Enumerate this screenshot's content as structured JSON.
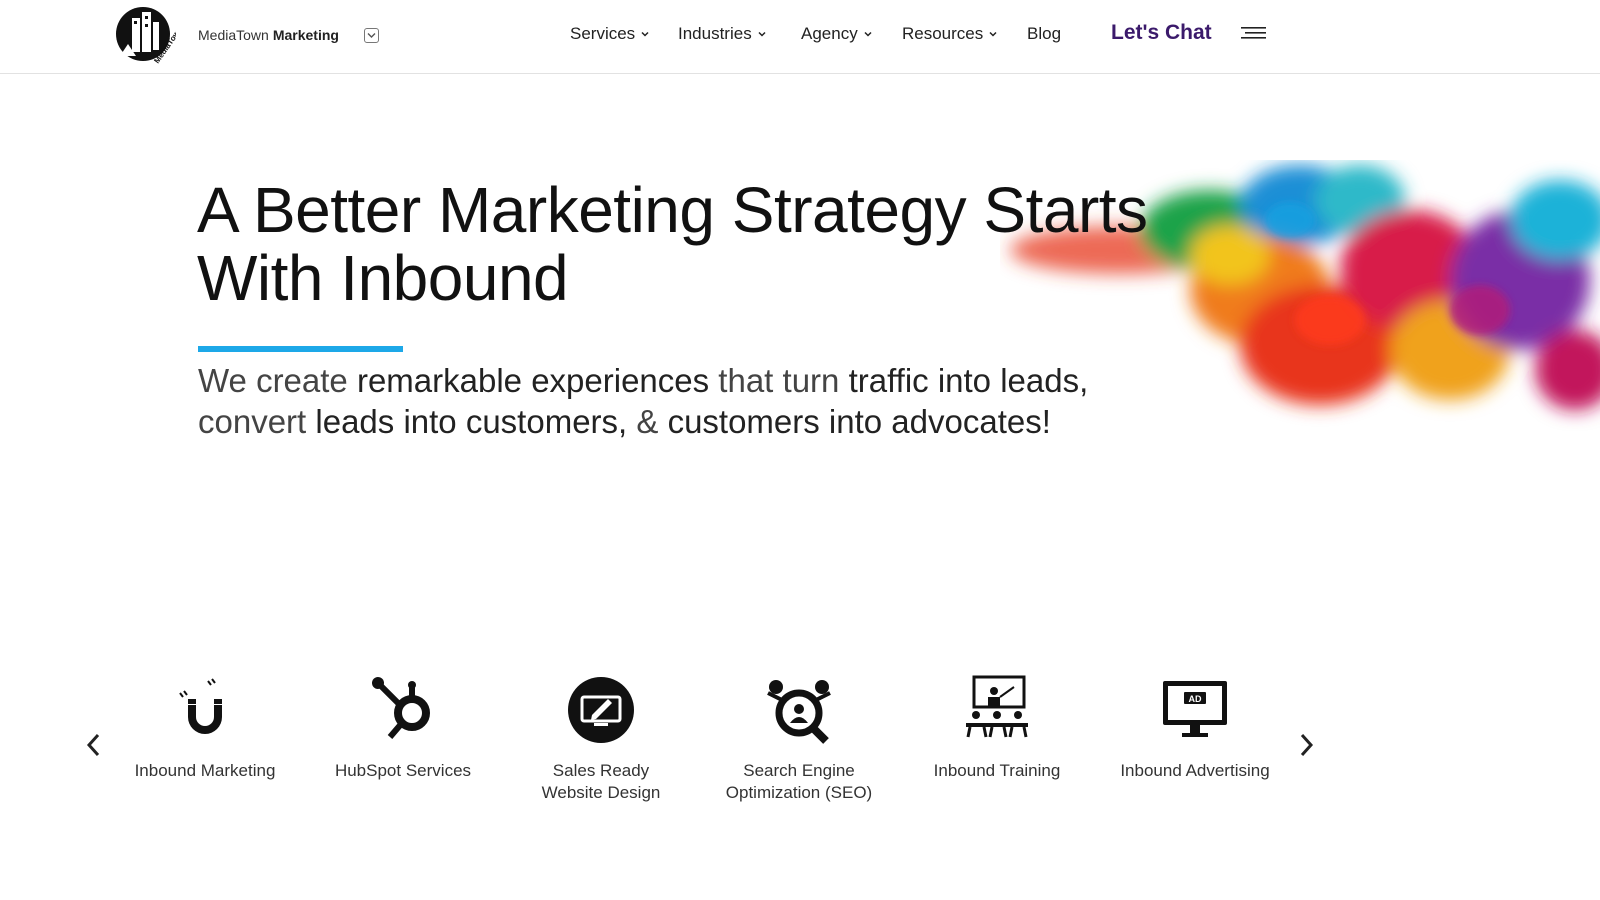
{
  "header": {
    "logo_text": "MediaTown",
    "brand_prefix": "MediaTown",
    "brand_bold": "Marketing",
    "nav": [
      {
        "label": "Services",
        "has_dropdown": true
      },
      {
        "label": "Industries",
        "has_dropdown": true
      },
      {
        "label": "Agency",
        "has_dropdown": true
      },
      {
        "label": "Resources",
        "has_dropdown": true
      },
      {
        "label": "Blog",
        "has_dropdown": false
      }
    ],
    "cta_label": "Let's Chat",
    "cta_color": "#3b1a6b"
  },
  "hero": {
    "title": "A Better Marketing Strategy Starts With Inbound",
    "accent_color": "#1da8e8",
    "subtitle_parts": [
      {
        "text": "We create ",
        "bold": false
      },
      {
        "text": "remarkable experiences",
        "bold": true
      },
      {
        "text": " that turn ",
        "bold": false
      },
      {
        "text": "traffic into leads,",
        "bold": true
      },
      {
        "text": " convert ",
        "bold": false
      },
      {
        "text": "leads into customers,",
        "bold": true
      },
      {
        "text": " & ",
        "bold": false
      },
      {
        "text": "customers into advocates!",
        "bold": true
      }
    ]
  },
  "services": [
    {
      "label": "Inbound Marketing",
      "icon": "magnet-icon"
    },
    {
      "label": "HubSpot Services",
      "icon": "hubspot-icon"
    },
    {
      "label": "Sales Ready\nWebsite Design",
      "icon": "monitor-edit-icon"
    },
    {
      "label": "Search Engine\nOptimization (SEO)",
      "icon": "seo-magnifier-icon"
    },
    {
      "label": "Inbound Training",
      "icon": "training-icon"
    },
    {
      "label": "Inbound Advertising",
      "icon": "ad-monitor-icon"
    }
  ]
}
